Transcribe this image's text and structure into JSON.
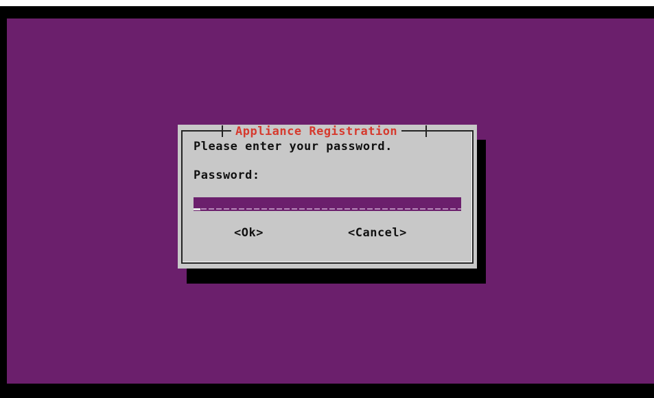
{
  "dialog": {
    "title": "Appliance Registration",
    "prompt": "Please enter your password.",
    "field_label": "Password:",
    "field_value": ""
  },
  "buttons": {
    "ok_label": "<Ok>",
    "cancel_label": "<Cancel>"
  },
  "colors": {
    "background": "#6b1f6c",
    "dialog": "#c8c8c8",
    "title_text": "#d63a2e",
    "field": "#6b1f6c"
  }
}
